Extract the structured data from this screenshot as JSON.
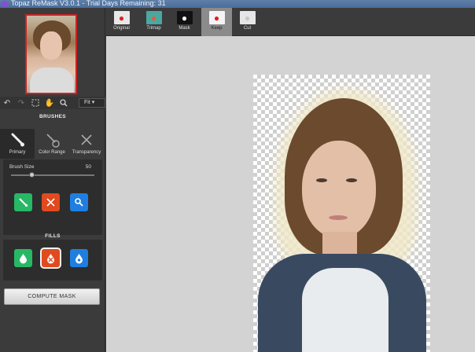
{
  "window": {
    "title": "Topaz ReMask V3.0.1 - Trial Days Remaining: 31"
  },
  "toolbar": {
    "zoom_select": "Fit"
  },
  "brushes": {
    "title": "BRUSHES",
    "tabs": [
      {
        "label": "Primary"
      },
      {
        "label": "Color Range"
      },
      {
        "label": "Transparency"
      }
    ],
    "size_label": "Brush Size",
    "size_value": "50",
    "size_fraction": 0.25
  },
  "fills": {
    "title": "FILLS"
  },
  "compute_button": "COMPUTE MASK",
  "view_tabs": [
    {
      "label": "Original"
    },
    {
      "label": "Trimap"
    },
    {
      "label": "Mask"
    },
    {
      "label": "Keep"
    },
    {
      "label": "Cut"
    }
  ],
  "colors": {
    "keep": "#27b866",
    "cut": "#e04a1f",
    "compute": "#1f7fe0",
    "selection": "#cc2222"
  }
}
